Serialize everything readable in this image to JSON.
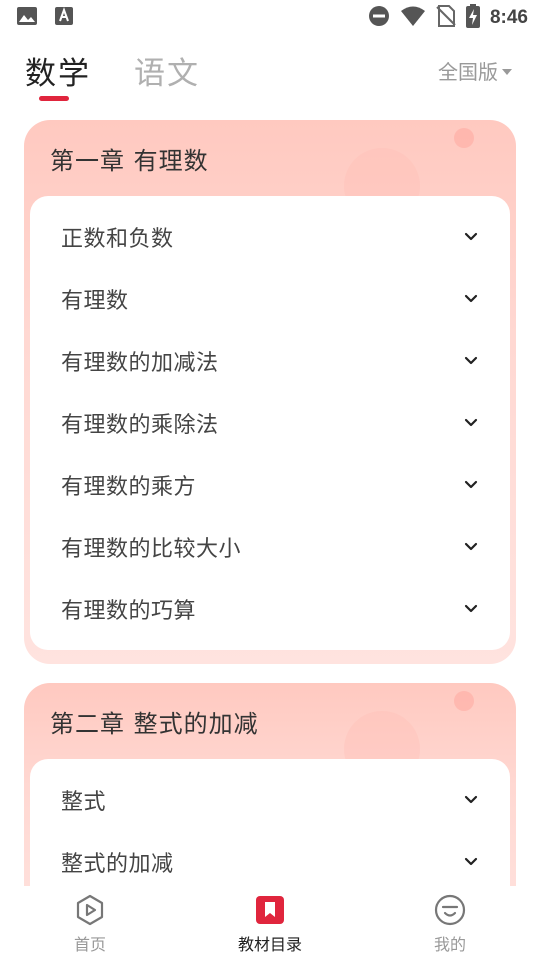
{
  "status_bar": {
    "time": "8:46",
    "icons": [
      "image-icon",
      "text-a-icon",
      "do-not-disturb-icon",
      "wifi-icon",
      "no-sim-icon",
      "battery-charging-icon"
    ]
  },
  "top_tabs": {
    "tabs": [
      {
        "label": "数学",
        "active": true
      },
      {
        "label": "语文",
        "active": false
      }
    ],
    "edition_label": "全国版",
    "accent_color": "#e0253d"
  },
  "chapters": [
    {
      "title": "第一章 有理数",
      "items": [
        {
          "label": "正数和负数"
        },
        {
          "label": "有理数"
        },
        {
          "label": "有理数的加减法"
        },
        {
          "label": "有理数的乘除法"
        },
        {
          "label": "有理数的乘方"
        },
        {
          "label": "有理数的比较大小"
        },
        {
          "label": "有理数的巧算"
        }
      ]
    },
    {
      "title": "第二章 整式的加减",
      "items": [
        {
          "label": "整式"
        },
        {
          "label": "整式的加减"
        }
      ]
    }
  ],
  "bottom_nav": {
    "items": [
      {
        "label": "首页",
        "icon": "play-icon",
        "active": false
      },
      {
        "label": "教材目录",
        "icon": "bookmark-icon",
        "active": true
      },
      {
        "label": "我的",
        "icon": "smile-icon",
        "active": false
      }
    ]
  }
}
